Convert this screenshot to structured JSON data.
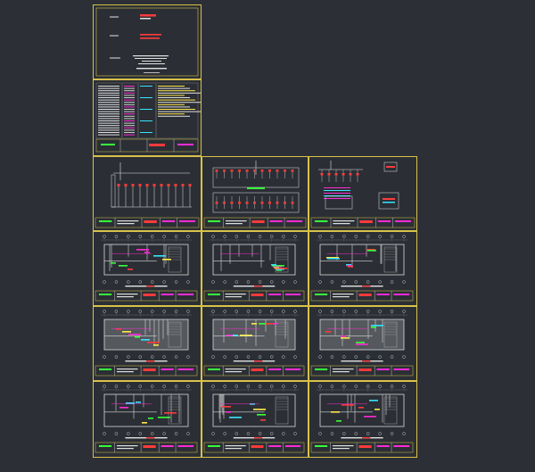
{
  "app": {
    "title": ""
  },
  "colors": {
    "background": "#2c3036",
    "sheet_border": "#d8c24a",
    "title_block_lines": "#e0e0e0",
    "wall_color": "#d8d8d8",
    "accent_red": "#ff3b3b",
    "accent_magenta": "#ff2bd6",
    "accent_green": "#37ff3b",
    "accent_cyan": "#37e3ff",
    "accent_yellow": "#ffe84a"
  },
  "sheets": [
    {
      "id": "cover",
      "kind": "cover"
    },
    {
      "id": "notes",
      "kind": "notes"
    },
    {
      "id": "schematic-1",
      "kind": "schematic"
    },
    {
      "id": "schematic-2",
      "kind": "schematic"
    },
    {
      "id": "schematic-3",
      "kind": "schematic"
    },
    {
      "id": "plan-1",
      "kind": "plan"
    },
    {
      "id": "plan-2",
      "kind": "plan"
    },
    {
      "id": "plan-3",
      "kind": "plan"
    },
    {
      "id": "plan-4",
      "kind": "plan"
    },
    {
      "id": "plan-5",
      "kind": "plan"
    },
    {
      "id": "plan-6",
      "kind": "plan"
    },
    {
      "id": "plan-7",
      "kind": "plan"
    },
    {
      "id": "plan-8",
      "kind": "plan"
    },
    {
      "id": "plan-9",
      "kind": "plan"
    }
  ]
}
